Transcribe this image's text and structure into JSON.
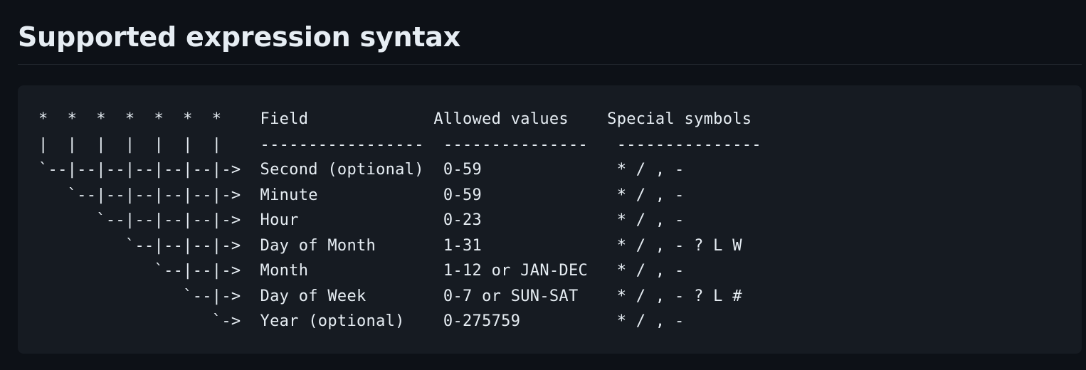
{
  "heading": "Supported expression syntax",
  "code_lines": [
    "*  *  *  *  *  *  *    Field             Allowed values    Special symbols",
    "|  |  |  |  |  |  |    -----------------  ---------------   ---------------",
    "`--|--|--|--|--|--|->  Second (optional)  0-59              * / , -",
    "   `--|--|--|--|--|->  Minute             0-59              * / , -",
    "      `--|--|--|--|->  Hour               0-23              * / , -",
    "         `--|--|--|->  Day of Month       1-31              * / , - ? L W",
    "            `--|--|->  Month              1-12 or JAN-DEC   * / , -",
    "               `--|->  Day of Week        0-7 or SUN-SAT    * / , - ? L #",
    "                  `->  Year (optional)    0-275759          * / , -"
  ]
}
